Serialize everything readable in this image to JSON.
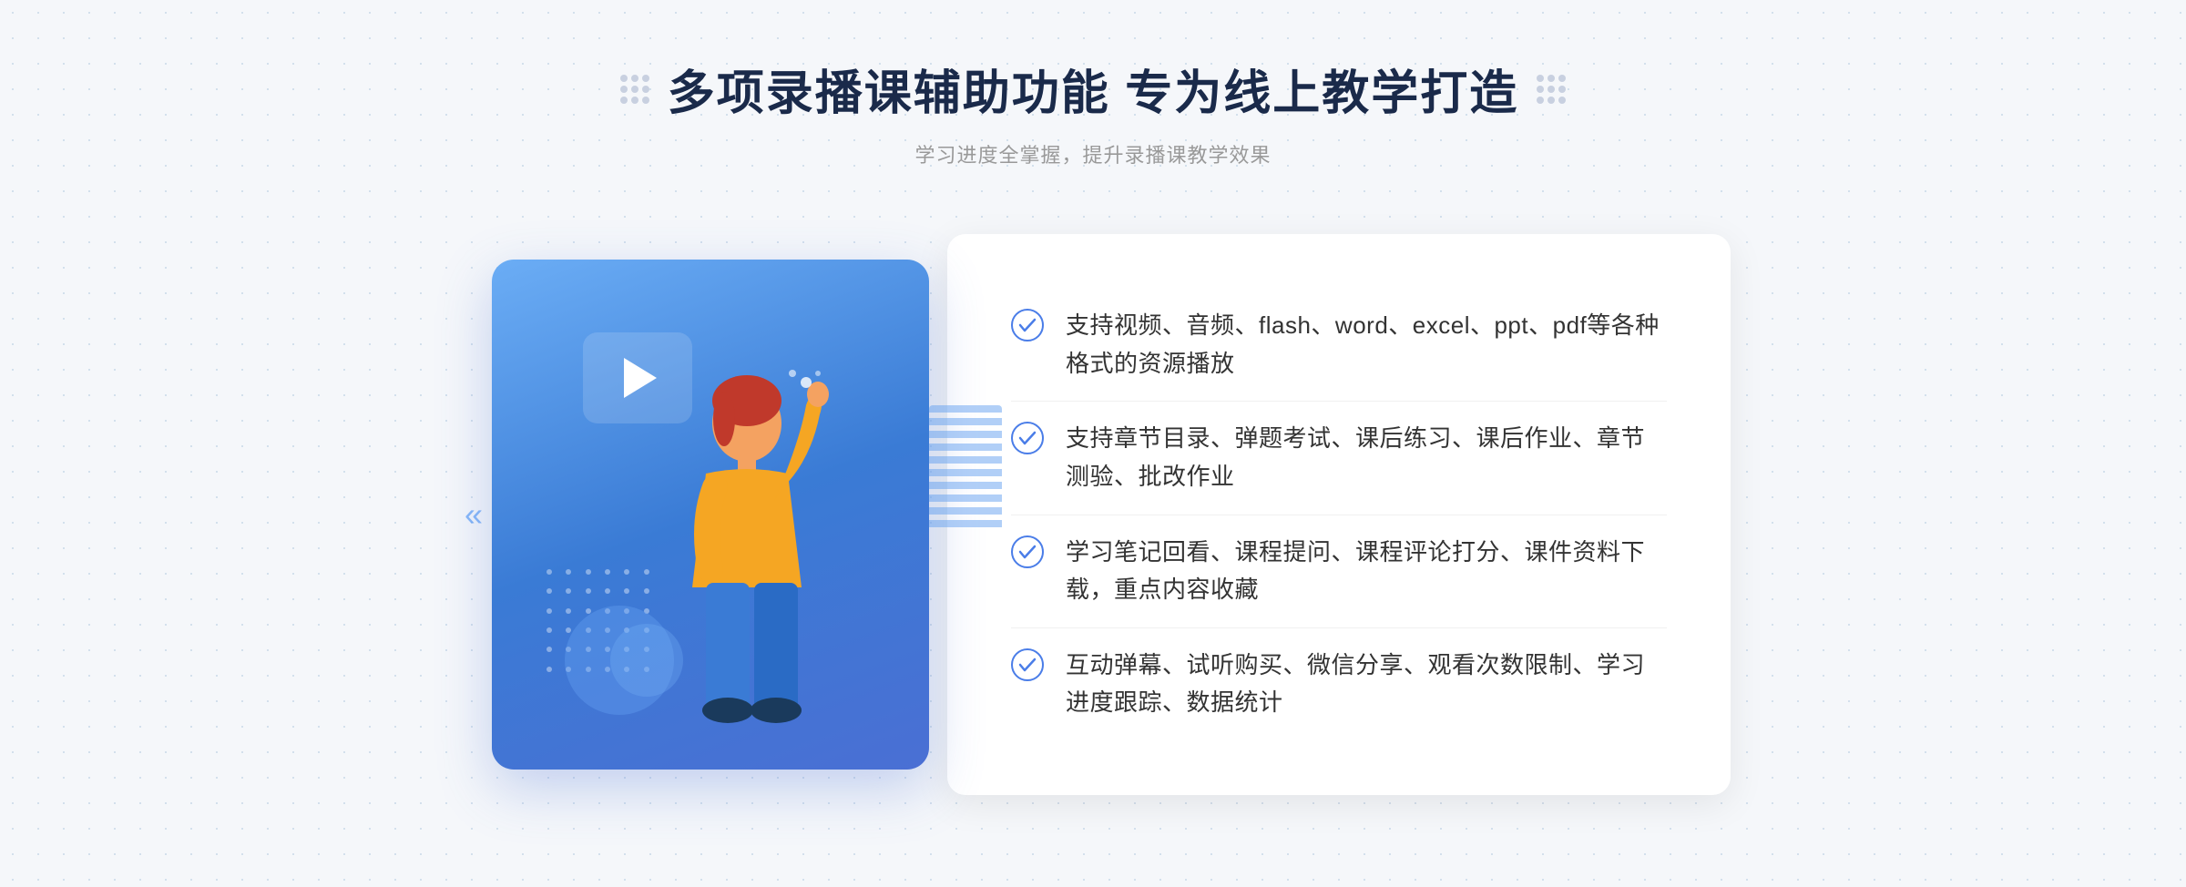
{
  "header": {
    "title": "多项录播课辅助功能 专为线上教学打造",
    "subtitle": "学习进度全掌握，提升录播课教学效果"
  },
  "features": [
    {
      "id": "feature-1",
      "text": "支持视频、音频、flash、word、excel、ppt、pdf等各种格式的资源播放"
    },
    {
      "id": "feature-2",
      "text": "支持章节目录、弹题考试、课后练习、课后作业、章节测验、批改作业"
    },
    {
      "id": "feature-3",
      "text": "学习笔记回看、课程提问、课程评论打分、课件资料下载，重点内容收藏"
    },
    {
      "id": "feature-4",
      "text": "互动弹幕、试听购买、微信分享、观看次数限制、学习进度跟踪、数据统计"
    }
  ],
  "colors": {
    "primary_blue": "#4a7de8",
    "light_blue": "#6badf5",
    "dark_blue": "#2a5bd0",
    "text_dark": "#1a2a4a",
    "text_gray": "#999999",
    "text_body": "#333333",
    "check_color": "#4a7de8",
    "bg_color": "#f5f7fa"
  },
  "decorations": {
    "arrow_symbol": "»",
    "left_arrow_symbol": "«"
  }
}
